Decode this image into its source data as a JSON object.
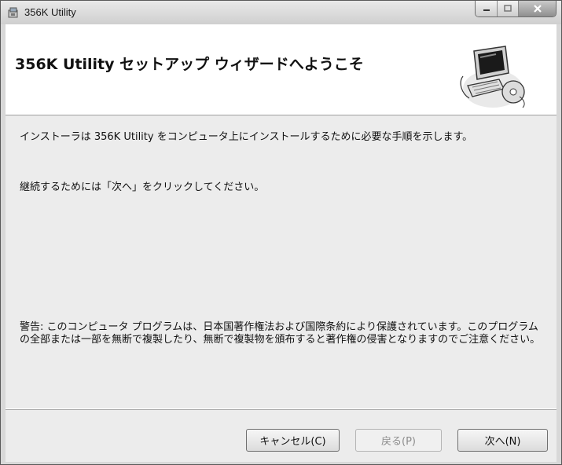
{
  "window": {
    "title": "356K Utility"
  },
  "banner": {
    "title": "356K Utility セットアップ ウィザードへようこそ"
  },
  "content": {
    "paragraph1": "インストーラは 356K Utility をコンピュータ上にインストールするために必要な手順を示します。",
    "paragraph2": "継続するためには「次へ」をクリックしてください。",
    "warning": "警告: このコンピュータ プログラムは、日本国著作権法および国際条約により保護されています。このプログラムの全部または一部を無断で複製したり、無断で複製物を頒布すると著作権の侵害となりますのでご注意ください。"
  },
  "buttons": {
    "cancel": "キャンセル(C)",
    "back": "戻る(P)",
    "next": "次へ(N)"
  },
  "icons": {
    "app": "installer-icon",
    "banner": "computer-disc-icon",
    "minimize": "minimize-icon",
    "maximize": "maximize-icon",
    "close": "close-icon"
  }
}
